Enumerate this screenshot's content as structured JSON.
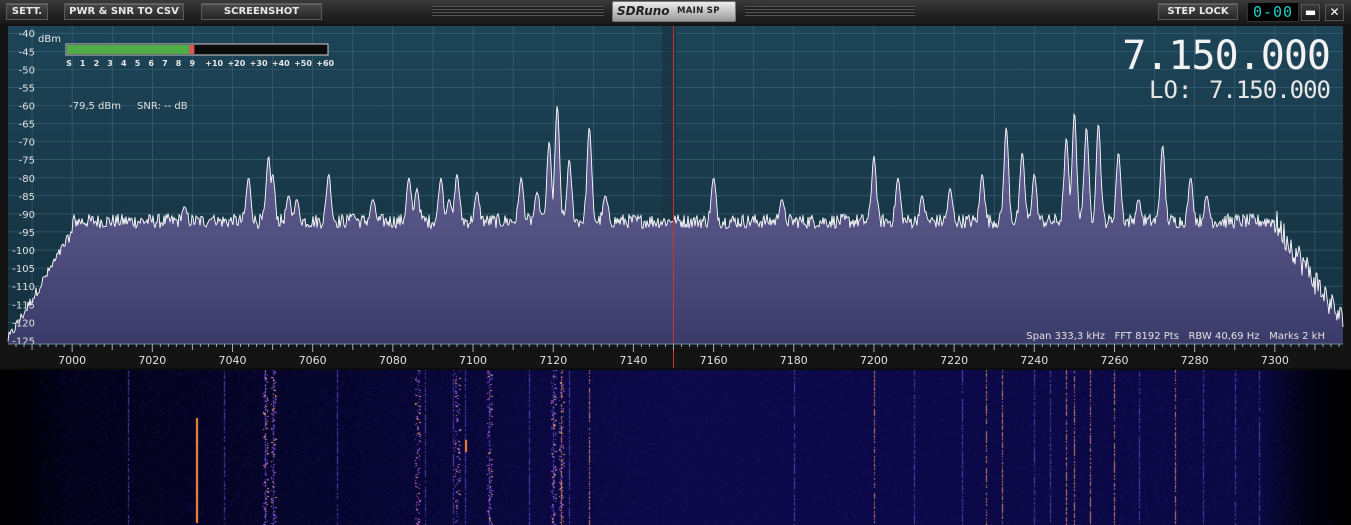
{
  "toolbar": {
    "sett_label": "SETT.",
    "pwr_snr_label": "PWR & SNR TO CSV",
    "screenshot_label": "SCREENSHOT",
    "step_lock_label": "STEP LOCK",
    "clock_value": "0-00",
    "minimize_symbol": "▬",
    "close_symbol": "✕"
  },
  "logo": {
    "name": "SDRuno",
    "window_name": "MAIN SP"
  },
  "spectrum": {
    "unit_label": "dBm",
    "y_ticks": [
      "-40",
      "-45",
      "-50",
      "-55",
      "-60",
      "-65",
      "-70",
      "-75",
      "-80",
      "-85",
      "-90",
      "-95",
      "-100",
      "-105",
      "-110",
      "-115",
      "-120",
      "-125"
    ],
    "x_ticks": [
      "7000",
      "7020",
      "7040",
      "7060",
      "7080",
      "7100",
      "7120",
      "7140",
      "7160",
      "7180",
      "7200",
      "7220",
      "7240",
      "7260",
      "7280",
      "7300"
    ],
    "smeter_scale": [
      "S",
      "1",
      "2",
      "3",
      "4",
      "5",
      "6",
      "7",
      "8",
      "9",
      "+10",
      "+20",
      "+30",
      "+40",
      "+50",
      "+60"
    ],
    "smeter_level_fraction": 0.49,
    "power_readout": "-79,5 dBm",
    "snr_readout": "SNR: -- dB",
    "frequency": "7.150.000",
    "lo_label": "LO:",
    "lo_frequency": "7.150.000",
    "info_line": "Span 333,3 kHz   FFT 8192 Pts   RBW 40,69 Hz   Marks 2 kH",
    "tuned_khz": 7150,
    "colors": {
      "background": "#1f4256",
      "grid": "#3d6478",
      "trace": "#ffffff",
      "fill_top": "#6c6a9c",
      "fill_bottom": "#3b3b6a",
      "tuning_line": "#d23232",
      "meter_green": "#4fae47",
      "meter_red": "#e0545a"
    }
  },
  "chart_data": {
    "type": "line",
    "xlabel": "",
    "ylabel": "dBm",
    "xlim": [
      6984,
      7317
    ],
    "ylim": [
      -126,
      -38
    ],
    "noise_floor_dbm": -92,
    "x": [
      6986,
      7000,
      7012,
      7028,
      7035,
      7040,
      7044,
      7049,
      7050,
      7054,
      7056,
      7064,
      7070,
      7075,
      7084,
      7086,
      7092,
      7094,
      7096,
      7101,
      7112,
      7116,
      7119,
      7121,
      7124,
      7129,
      7133,
      7150,
      7160,
      7177,
      7200,
      7206,
      7212,
      7219,
      7227,
      7233,
      7237,
      7240,
      7248,
      7250,
      7253,
      7256,
      7261,
      7266,
      7272,
      7279,
      7283,
      7300,
      7310,
      7315
    ],
    "y": [
      -122,
      -96,
      -93,
      -88,
      -91,
      -93,
      -80,
      -74,
      -79,
      -85,
      -86,
      -79,
      -90,
      -86,
      -80,
      -83,
      -80,
      -86,
      -79,
      -84,
      -80,
      -84,
      -70,
      -60,
      -75,
      -66,
      -85,
      -92,
      -80,
      -86,
      -74,
      -80,
      -85,
      -83,
      -79,
      -66,
      -73,
      -79,
      -69,
      -62,
      -66,
      -65,
      -73,
      -86,
      -71,
      -80,
      -85,
      -91,
      -98,
      -118
    ],
    "series": [
      {
        "values": [
          -122,
          -96,
          -93,
          -88,
          -91,
          -93,
          -80,
          -74,
          -79,
          -85,
          -86,
          -79,
          -90,
          -86,
          -80,
          -83,
          -80,
          -86,
          -79,
          -84,
          -80,
          -84,
          -70,
          -60,
          -75,
          -66,
          -85,
          -92,
          -80,
          -86,
          -74,
          -80,
          -85,
          -83,
          -79,
          -66,
          -73,
          -79,
          -69,
          -62,
          -66,
          -65,
          -73,
          -86,
          -71,
          -80,
          -85,
          -91,
          -98,
          -118
        ]
      }
    ],
    "grid": true
  },
  "waterfall": {
    "strong_lines_khz": [
      7122,
      7129,
      7200,
      7228,
      7232,
      7248,
      7250,
      7254,
      7260,
      7275
    ],
    "medium_lines_khz": [
      7014,
      7038,
      7048,
      7050,
      7066,
      7088,
      7095,
      7098,
      7104,
      7114,
      7120,
      7124,
      7180,
      7210,
      7222,
      7240,
      7244,
      7266,
      7282,
      7290,
      7296
    ],
    "burst_lines_khz": [
      7048,
      7050,
      7086,
      7096,
      7120,
      7122,
      7104
    ]
  }
}
